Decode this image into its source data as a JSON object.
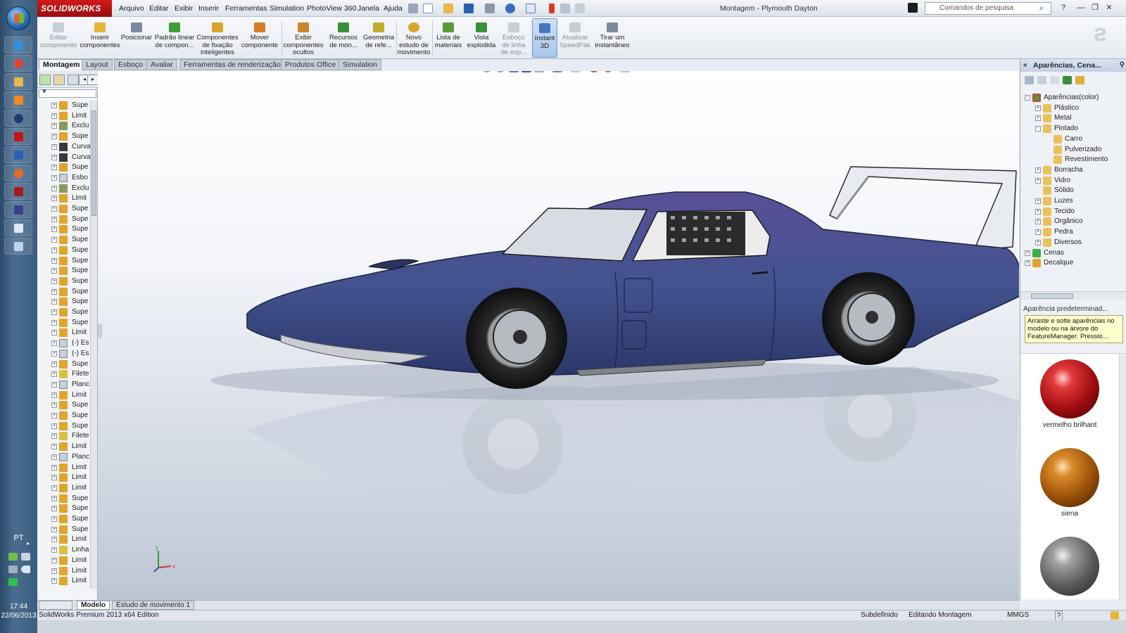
{
  "taskbar": {
    "language": "PT",
    "time": "17:44",
    "date": "22/06/2013"
  },
  "window": {
    "brand": "SOLIDWORKS",
    "title": "Montagem - Plymouth Dayton",
    "search_placeholder": "Comandos de pesquisa"
  },
  "menu": [
    "Arquivo",
    "Editar",
    "Exibir",
    "Inserir",
    "Ferramentas",
    "Simulation",
    "PhotoView 360",
    "Janela",
    "Ajuda"
  ],
  "ribbon": {
    "editar_componente": [
      "Editar",
      "componente"
    ],
    "inserir_componentes": [
      "Inserir",
      "componentes"
    ],
    "posicionar": [
      "Posicionar"
    ],
    "padrao_linear": [
      "Padrão linear",
      "de compon..."
    ],
    "componentes_fixacao": [
      "Componentes",
      "de fixação",
      "inteligentes"
    ],
    "mover_componente": [
      "Mover",
      "componente"
    ],
    "exibir_componentes": [
      "Exibir",
      "componentes",
      "ocultos"
    ],
    "recursos_montagem": [
      "Recursos",
      "de mon..."
    ],
    "geometria_referencia": [
      "Geometria",
      "de refe..."
    ],
    "novo_estudo": [
      "Novo",
      "estudo de",
      "movimento"
    ],
    "lista_materiais": [
      "Lista de",
      "materiais"
    ],
    "vista_explodida": [
      "Vista",
      "explodida"
    ],
    "esboco_linha": [
      "Esboço",
      "de linha",
      "de exp..."
    ],
    "instant3d": [
      "Instant",
      "3D"
    ],
    "atualizar_speedpak": [
      "Atualizar",
      "SpeedPak"
    ],
    "tirar_instantaneo": [
      "Tirar um",
      "instantâneo"
    ]
  },
  "tabs": [
    "Montagem",
    "Layout",
    "Esboço",
    "Avaliar",
    "Ferramentas de renderização",
    "Produtos Office",
    "Simulation"
  ],
  "tree": {
    "items": [
      {
        "label": "Supe",
        "type": "surface"
      },
      {
        "label": "Limit",
        "type": "limit"
      },
      {
        "label": "Exclu",
        "type": "exclude"
      },
      {
        "label": "Supe",
        "type": "surface"
      },
      {
        "label": "Curva",
        "type": "curve"
      },
      {
        "label": "Curva",
        "type": "curve"
      },
      {
        "label": "Supe",
        "type": "surface"
      },
      {
        "label": "Esbo",
        "type": "sketch"
      },
      {
        "label": "Exclu",
        "type": "exclude"
      },
      {
        "label": "Limit",
        "type": "limit"
      },
      {
        "label": "Supe",
        "type": "surface"
      },
      {
        "label": "Supe",
        "type": "surface"
      },
      {
        "label": "Supe",
        "type": "surface"
      },
      {
        "label": "Supe",
        "type": "surface"
      },
      {
        "label": "Supe",
        "type": "surface"
      },
      {
        "label": "Supe",
        "type": "surface"
      },
      {
        "label": "Supe",
        "type": "surface"
      },
      {
        "label": "Supe",
        "type": "surface"
      },
      {
        "label": "Supe",
        "type": "surface"
      },
      {
        "label": "Supe",
        "type": "surface"
      },
      {
        "label": "Supe",
        "type": "surface"
      },
      {
        "label": "Supe",
        "type": "surface"
      },
      {
        "label": "Limit",
        "type": "limit"
      },
      {
        "label": "(-) Es",
        "type": "sketch"
      },
      {
        "label": "(-) Es",
        "type": "sketch"
      },
      {
        "label": "Supe",
        "type": "surface"
      },
      {
        "label": "Filete",
        "type": "fillet"
      },
      {
        "label": "Planc",
        "type": "plane"
      },
      {
        "label": "Limit",
        "type": "limit"
      },
      {
        "label": "Supe",
        "type": "surface"
      },
      {
        "label": "Supe",
        "type": "surface"
      },
      {
        "label": "Supe",
        "type": "surface"
      },
      {
        "label": "Filete",
        "type": "fillet"
      },
      {
        "label": "Limit",
        "type": "limit"
      },
      {
        "label": "Planc",
        "type": "plane"
      },
      {
        "label": "Limit",
        "type": "limit"
      },
      {
        "label": "Limit",
        "type": "limit"
      },
      {
        "label": "Limit",
        "type": "limit"
      },
      {
        "label": "Supe",
        "type": "surface"
      },
      {
        "label": "Supe",
        "type": "surface"
      },
      {
        "label": "Supe",
        "type": "surface"
      },
      {
        "label": "Supe",
        "type": "surface"
      },
      {
        "label": "Limit",
        "type": "limit"
      },
      {
        "label": "Linha",
        "type": "fillet"
      },
      {
        "label": "Limit",
        "type": "limit"
      },
      {
        "label": "Limit",
        "type": "limit"
      },
      {
        "label": "Limit",
        "type": "limit"
      }
    ]
  },
  "pane": {
    "title": "Aparências, Cena...",
    "tree": [
      {
        "label": "Aparências(color)",
        "level": 0,
        "expand": "-"
      },
      {
        "label": "Plástico",
        "level": 1,
        "expand": "+"
      },
      {
        "label": "Metal",
        "level": 1,
        "expand": "+"
      },
      {
        "label": "Pintado",
        "level": 1,
        "expand": "-"
      },
      {
        "label": "Carro",
        "level": 2,
        "expand": ""
      },
      {
        "label": "Pulverizado",
        "level": 2,
        "expand": ""
      },
      {
        "label": "Revestimento",
        "level": 2,
        "expand": ""
      },
      {
        "label": "Borracha",
        "level": 1,
        "expand": "+"
      },
      {
        "label": "Vidro",
        "level": 1,
        "expand": "+"
      },
      {
        "label": "Sólido",
        "level": 1,
        "expand": ""
      },
      {
        "label": "Luzes",
        "level": 1,
        "expand": "+"
      },
      {
        "label": "Tecido",
        "level": 1,
        "expand": "+"
      },
      {
        "label": "Orgânico",
        "level": 1,
        "expand": "+"
      },
      {
        "label": "Pedra",
        "level": 1,
        "expand": "+"
      },
      {
        "label": "Diversos",
        "level": 1,
        "expand": "+"
      },
      {
        "label": "Cenas",
        "level": 0,
        "expand": "+"
      },
      {
        "label": "Decalque",
        "level": 0,
        "expand": "+"
      }
    ],
    "appearance_title": "Aparência predeterminad...",
    "tooltip": "Arraste e solte aparências no modelo ou na árvore do FeatureManager. Pressio...",
    "swatches": [
      {
        "label": "vermelho brilhant",
        "color": "#c0141a"
      },
      {
        "label": "siena",
        "color": "#b8620e"
      },
      {
        "label": "",
        "color": "#8a8a8a"
      }
    ]
  },
  "bottom_tabs": [
    "Modelo",
    "Estudo de movimento 1"
  ],
  "status": {
    "edition": "SolidWorks Premium 2013 x64 Edition",
    "state": "Subdefinido",
    "mode": "Editando Montagem",
    "units": "MMGS",
    "help": "?"
  },
  "colors": {
    "brand_red": "#c31515",
    "car_body": "#3f4f8f"
  }
}
